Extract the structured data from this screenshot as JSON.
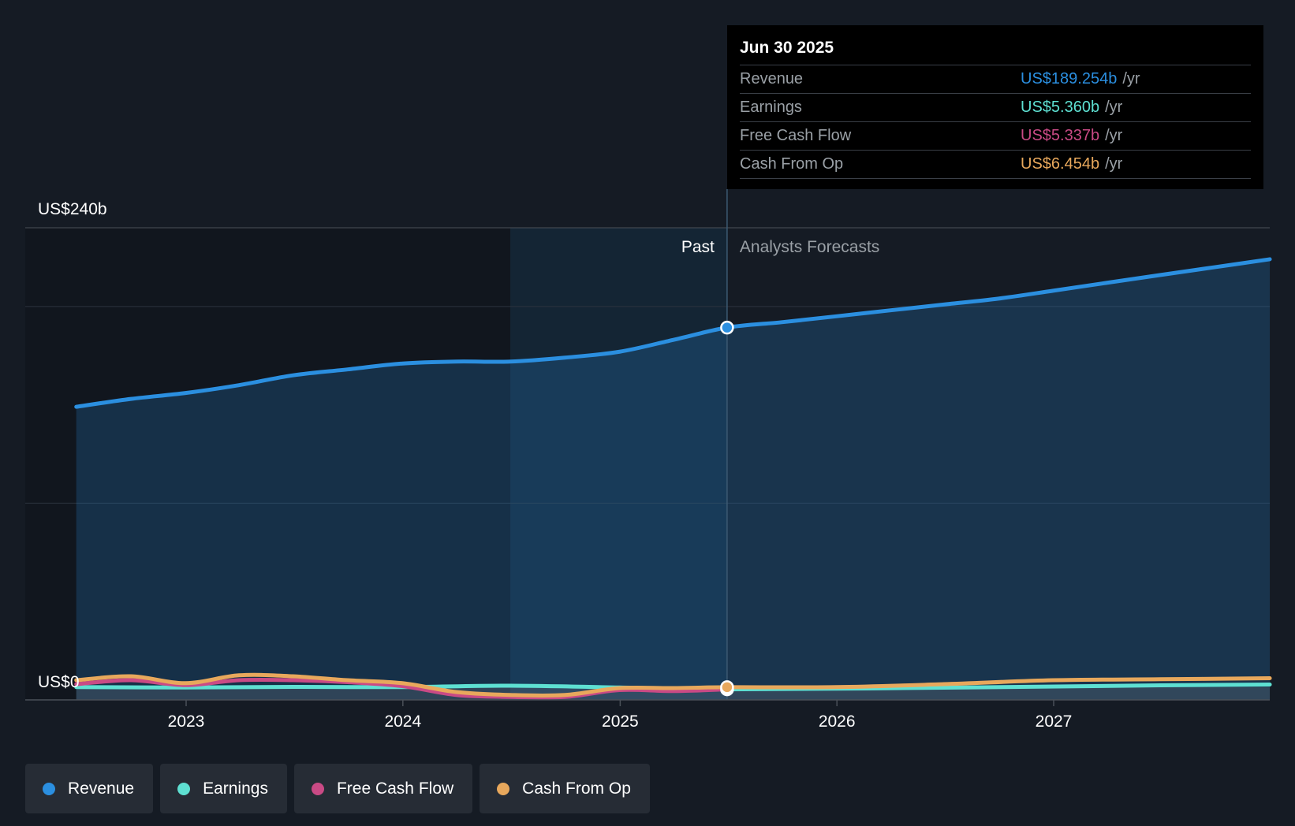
{
  "chart_data": {
    "type": "area",
    "x_ticks": [
      "2023",
      "2024",
      "2025",
      "2026",
      "2027"
    ],
    "y_label_top": "US$240b",
    "y_label_bottom": "US$0",
    "ylim": [
      0,
      240
    ],
    "xlim": [
      "2022-06-30",
      "2027-12-31"
    ],
    "divider_date": "2025-06-30",
    "past_label": "Past",
    "forecast_label": "Analysts Forecasts",
    "highlight_band_start": "2024-06-30",
    "series": [
      {
        "name": "Revenue",
        "color": "#2b8fe0",
        "points": [
          [
            "2022-06-30",
            149
          ],
          [
            "2022-09-30",
            153
          ],
          [
            "2022-12-31",
            156
          ],
          [
            "2023-03-31",
            160
          ],
          [
            "2023-06-30",
            165
          ],
          [
            "2023-09-30",
            168
          ],
          [
            "2023-12-31",
            171
          ],
          [
            "2024-03-31",
            172
          ],
          [
            "2024-06-30",
            172
          ],
          [
            "2024-09-30",
            174
          ],
          [
            "2024-12-31",
            177
          ],
          [
            "2025-03-31",
            183
          ],
          [
            "2025-06-30",
            189.254
          ],
          [
            "2025-09-30",
            192
          ],
          [
            "2025-12-31",
            195
          ],
          [
            "2026-03-31",
            198
          ],
          [
            "2026-06-30",
            201
          ],
          [
            "2026-09-30",
            204
          ],
          [
            "2026-12-31",
            208
          ],
          [
            "2027-03-31",
            212
          ],
          [
            "2027-06-30",
            216
          ],
          [
            "2027-09-30",
            220
          ],
          [
            "2027-12-31",
            224
          ]
        ]
      },
      {
        "name": "Earnings",
        "color": "#5ee0d2",
        "points": [
          [
            "2022-06-30",
            6.5
          ],
          [
            "2022-12-31",
            6.3
          ],
          [
            "2023-06-30",
            6.6
          ],
          [
            "2023-12-31",
            6.5
          ],
          [
            "2024-06-30",
            7.2
          ],
          [
            "2024-12-31",
            6.3
          ],
          [
            "2025-06-30",
            5.36
          ],
          [
            "2026-06-30",
            6.2
          ],
          [
            "2027-06-30",
            7.4
          ],
          [
            "2027-12-31",
            7.8
          ]
        ]
      },
      {
        "name": "Free Cash Flow",
        "color": "#c94a85",
        "points": [
          [
            "2022-06-30",
            8
          ],
          [
            "2022-09-30",
            10
          ],
          [
            "2022-12-31",
            7.5
          ],
          [
            "2023-03-31",
            10
          ],
          [
            "2023-06-30",
            10
          ],
          [
            "2023-09-30",
            9
          ],
          [
            "2023-12-31",
            7
          ],
          [
            "2024-03-31",
            2.5
          ],
          [
            "2024-06-30",
            1.5
          ],
          [
            "2024-09-30",
            1.5
          ],
          [
            "2024-12-31",
            5
          ],
          [
            "2025-03-31",
            4.5
          ],
          [
            "2025-06-30",
            5.337
          ]
        ]
      },
      {
        "name": "Cash From Op",
        "color": "#e8a85c",
        "points": [
          [
            "2022-06-30",
            10
          ],
          [
            "2022-09-30",
            12
          ],
          [
            "2022-12-31",
            8.5
          ],
          [
            "2023-03-31",
            12.5
          ],
          [
            "2023-06-30",
            12
          ],
          [
            "2023-09-30",
            10
          ],
          [
            "2023-12-31",
            8.5
          ],
          [
            "2024-03-31",
            4
          ],
          [
            "2024-06-30",
            2.5
          ],
          [
            "2024-09-30",
            2.5
          ],
          [
            "2024-12-31",
            6
          ],
          [
            "2025-03-31",
            6
          ],
          [
            "2025-06-30",
            6.454
          ],
          [
            "2025-12-31",
            6.5
          ],
          [
            "2026-06-30",
            8
          ],
          [
            "2026-12-31",
            10
          ],
          [
            "2027-06-30",
            10.5
          ],
          [
            "2027-12-31",
            11
          ]
        ]
      }
    ]
  },
  "tooltip": {
    "date": "Jun 30 2025",
    "unit": "/yr",
    "rows": [
      {
        "label": "Revenue",
        "value": "US$189.254b",
        "color": "#2b8fe0"
      },
      {
        "label": "Earnings",
        "value": "US$5.360b",
        "color": "#5ee0d2"
      },
      {
        "label": "Free Cash Flow",
        "value": "US$5.337b",
        "color": "#c94a85"
      },
      {
        "label": "Cash From Op",
        "value": "US$6.454b",
        "color": "#e8a85c"
      }
    ]
  },
  "legend": [
    {
      "label": "Revenue",
      "color": "#2b8fe0"
    },
    {
      "label": "Earnings",
      "color": "#5ee0d2"
    },
    {
      "label": "Free Cash Flow",
      "color": "#c94a85"
    },
    {
      "label": "Cash From Op",
      "color": "#e8a85c"
    }
  ]
}
